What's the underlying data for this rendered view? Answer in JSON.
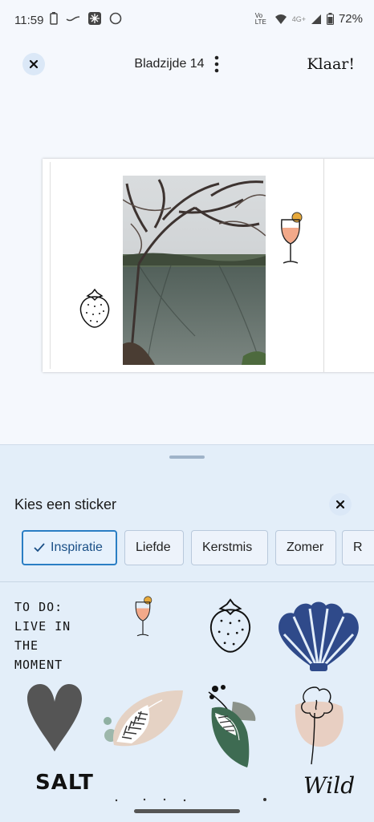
{
  "status": {
    "time": "11:59",
    "battery": "72%",
    "volte": "Vo LTE",
    "network": "4G+"
  },
  "header": {
    "title": "Bladzijde 14",
    "done_label": "Klaar!"
  },
  "sheet": {
    "title": "Kies een sticker",
    "chips": [
      {
        "label": "Inspiratie",
        "selected": true
      },
      {
        "label": "Liefde"
      },
      {
        "label": "Kerstmis"
      },
      {
        "label": "Zomer"
      },
      {
        "label": "R"
      }
    ]
  },
  "stickers": {
    "todo_lines": [
      "TO DO:",
      "LIVE IN",
      "THE",
      "MOMENT"
    ],
    "salt": "SALT",
    "wild": "Wild"
  },
  "colors": {
    "accent": "#2a7ec4",
    "sheet_bg": "#e3eef9",
    "shell": "#2f4a8a"
  }
}
